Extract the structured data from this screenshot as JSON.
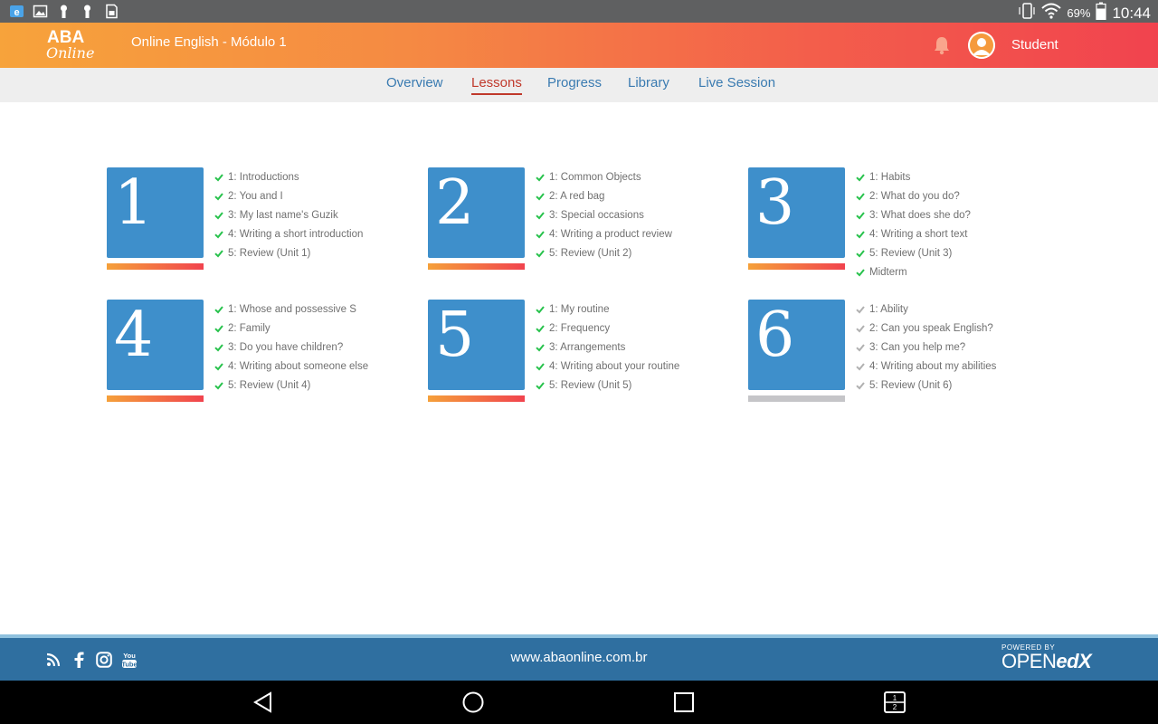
{
  "statusbar": {
    "battery_pct": "69%",
    "time": "10:44"
  },
  "header": {
    "logo_line1": "ABA",
    "logo_line2": "Online",
    "course_title": "Online English - Módulo 1",
    "user_name": "Student"
  },
  "tabs": [
    {
      "label": "Overview",
      "active": false
    },
    {
      "label": "Lessons",
      "active": true
    },
    {
      "label": "Progress",
      "active": false
    },
    {
      "label": "Library",
      "active": false
    },
    {
      "label": "Live Session",
      "active": false
    }
  ],
  "units": [
    {
      "number": "1",
      "completed": true,
      "lessons": [
        {
          "label": "1: Introductions",
          "done": true
        },
        {
          "label": "2: You and I",
          "done": true
        },
        {
          "label": "3: My last name's Guzik",
          "done": true
        },
        {
          "label": "4: Writing a short introduction",
          "done": true
        },
        {
          "label": "5: Review (Unit 1)",
          "done": true
        }
      ]
    },
    {
      "number": "2",
      "completed": true,
      "lessons": [
        {
          "label": "1: Common Objects",
          "done": true
        },
        {
          "label": "2: A red bag",
          "done": true
        },
        {
          "label": "3: Special occasions",
          "done": true
        },
        {
          "label": "4: Writing a product review",
          "done": true
        },
        {
          "label": "5: Review (Unit 2)",
          "done": true
        }
      ]
    },
    {
      "number": "3",
      "completed": true,
      "lessons": [
        {
          "label": "1: Habits",
          "done": true
        },
        {
          "label": "2: What do you do?",
          "done": true
        },
        {
          "label": "3: What does she do?",
          "done": true
        },
        {
          "label": "4: Writing a short text",
          "done": true
        },
        {
          "label": "5: Review (Unit 3)",
          "done": true
        },
        {
          "label": "Midterm",
          "done": true
        }
      ]
    },
    {
      "number": "4",
      "completed": true,
      "lessons": [
        {
          "label": "1: Whose and possessive S",
          "done": true
        },
        {
          "label": "2: Family",
          "done": true
        },
        {
          "label": "3: Do you have children?",
          "done": true
        },
        {
          "label": "4: Writing about someone else",
          "done": true
        },
        {
          "label": "5: Review (Unit 4)",
          "done": true
        }
      ]
    },
    {
      "number": "5",
      "completed": true,
      "lessons": [
        {
          "label": "1: My routine",
          "done": true
        },
        {
          "label": "2: Frequency",
          "done": true
        },
        {
          "label": "3: Arrangements",
          "done": true
        },
        {
          "label": "4: Writing about your routine",
          "done": true
        },
        {
          "label": "5: Review (Unit 5)",
          "done": true
        }
      ]
    },
    {
      "number": "6",
      "completed": false,
      "lessons": [
        {
          "label": "1: Ability",
          "done": false
        },
        {
          "label": "2: Can you speak English?",
          "done": false
        },
        {
          "label": "3: Can you help me?",
          "done": false
        },
        {
          "label": "4: Writing about my abilities",
          "done": false
        },
        {
          "label": "5: Review (Unit 6)",
          "done": false
        }
      ]
    }
  ],
  "footer": {
    "url": "www.abaonline.com.br",
    "powered_by": "POWERED BY",
    "openedx_open": "OPEN",
    "openedx_edx": "edX"
  },
  "colors": {
    "check_done": "#27c24c",
    "check_pending": "#b0b0b0",
    "unit_box": "#3e8fcb"
  },
  "icons": {
    "statusbar_left": [
      "browser-icon",
      "gallery-icon",
      "keyhole-icon",
      "keyhole-icon",
      "sd-card-icon"
    ],
    "social": [
      "rss-icon",
      "facebook-icon",
      "instagram-icon",
      "youtube-icon"
    ],
    "navbar": [
      "back-icon",
      "home-icon",
      "recents-icon",
      "split-screen-icon"
    ]
  }
}
